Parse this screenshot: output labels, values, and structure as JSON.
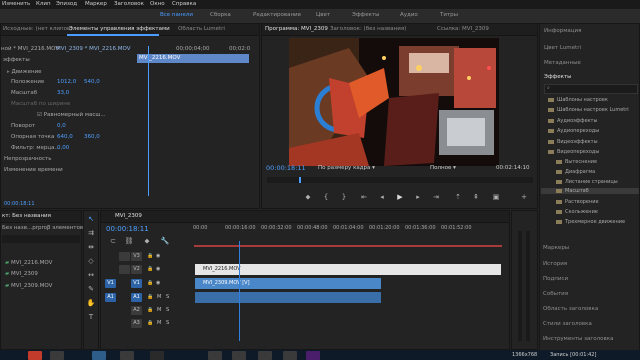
{
  "menubar": [
    "Изменить",
    "Клип",
    "Эпизод",
    "Маркер",
    "Заголовок",
    "Окно",
    "Справка"
  ],
  "workspaces": [
    {
      "label": "Все панели",
      "active": true
    },
    {
      "label": "Сборка",
      "active": false
    },
    {
      "label": "Редактирование",
      "active": false
    },
    {
      "label": "Цвет",
      "active": false
    },
    {
      "label": "Эффекты",
      "active": false
    },
    {
      "label": "Аудио",
      "active": false
    },
    {
      "label": "Титры",
      "active": false
    }
  ],
  "source_panel": {
    "tabs": [
      "Исходные: (нет клипов)",
      "Элементы управления эффектами",
      "Область Lumetri"
    ],
    "header_path": "ной * MVI_2216.MOV",
    "header_seq": "MVI_2309 * MVI_2216.MOV",
    "ruler_times": [
      "00;00;04;00",
      "00;02:0"
    ],
    "clip_name": "MVI_2216.MOV",
    "section": "эффекты",
    "rows": [
      {
        "label": "Движение",
        "value1": "",
        "value2": ""
      },
      {
        "label": "Положение",
        "value1": "1012,0",
        "value2": "540,0"
      },
      {
        "label": "Масштаб",
        "value1": "33,0",
        "value2": ""
      },
      {
        "label": "Масштаб по ширине",
        "value1": "",
        "value2": ""
      },
      {
        "label": "Равномерный масш...",
        "value1": "",
        "value2": ""
      },
      {
        "label": "Поворот",
        "value1": "0,0",
        "value2": ""
      },
      {
        "label": "Опорная точка",
        "value1": "640,0",
        "value2": "360,0"
      },
      {
        "label": "Фильтр: мерца...",
        "value1": "0,00",
        "value2": ""
      },
      {
        "label": "Непрозрачность",
        "value1": "",
        "value2": ""
      },
      {
        "label": "Изменение времени",
        "value1": "",
        "value2": ""
      }
    ],
    "timecode": "00:00:18:11"
  },
  "program_monitor": {
    "tabs": [
      "Программа: MVI_2309",
      "Заголовок: (без названия)",
      "Ссылка: MVI_2309"
    ],
    "timecode": "00:00:18:11",
    "fit": "По размеру кадра",
    "quality": "Полное",
    "duration": "00:02:14:10"
  },
  "right_panel": {
    "items_top": [
      "Информация",
      "Цвет Lumetri",
      "Метаданные"
    ],
    "effects_tab": "Эффекты",
    "effects_tree": [
      {
        "label": "Шаблоны настроек",
        "indent": 0,
        "open": false
      },
      {
        "label": "Шаблоны настроек Lumetri",
        "indent": 0,
        "open": false
      },
      {
        "label": "Аудиоэффекты",
        "indent": 0,
        "open": false
      },
      {
        "label": "Аудиопереходы",
        "indent": 0,
        "open": false
      },
      {
        "label": "Видеоэффекты",
        "indent": 0,
        "open": false
      },
      {
        "label": "Видеопереходы",
        "indent": 0,
        "open": true
      },
      {
        "label": "Вытеснение",
        "indent": 1,
        "open": false
      },
      {
        "label": "Диафрагма",
        "indent": 1,
        "open": false
      },
      {
        "label": "Листание страницы",
        "indent": 1,
        "open": false
      },
      {
        "label": "Масштаб",
        "indent": 1,
        "open": false,
        "selected": true
      },
      {
        "label": "Растворение",
        "indent": 1,
        "open": false
      },
      {
        "label": "Скольжение",
        "indent": 1,
        "open": false
      },
      {
        "label": "Трехмерное движение",
        "indent": 1,
        "open": false
      }
    ],
    "items_bottom": [
      "Маркеры",
      "История",
      "Подписи",
      "События",
      "Область заголовка",
      "Стили заголовка",
      "Инструменты заголовка"
    ]
  },
  "project_panel": {
    "title": "кт: Без названия",
    "subtitle": "Без назв...prproj",
    "count": "3 элементов",
    "items": [
      "MVI_2216.MOV",
      "MVI_2309",
      "MVI_2309.MOV"
    ]
  },
  "timeline": {
    "tab": "MVI_2309",
    "timecode": "00:00:18:11",
    "ruler": [
      "00:00",
      "00:00:16:00",
      "00:00:32:00",
      "00:00:48:00",
      "00:01:04:00",
      "00:01:20:00",
      "00:01:36:00",
      "00:01:52:00"
    ],
    "tracks": [
      {
        "name": "V3",
        "type": "video",
        "selected": false
      },
      {
        "name": "V2",
        "type": "video",
        "selected": false
      },
      {
        "name": "V1",
        "type": "video",
        "selected": true
      },
      {
        "name": "A1",
        "type": "audio",
        "selected": true
      },
      {
        "name": "A2",
        "type": "audio",
        "selected": false
      },
      {
        "name": "A3",
        "type": "audio",
        "selected": false
      }
    ],
    "clips": [
      {
        "label": "MVI_2216.MOV",
        "track": "V2"
      },
      {
        "label": "MVI_2309.MOV [V]",
        "track": "V1"
      },
      {
        "label": "",
        "track": "A1"
      }
    ]
  },
  "statusbar": {
    "resolution": "1366x768",
    "recording": "Запись [00:01:42]"
  },
  "colors": {
    "accent": "#4c9cff",
    "playhead": "#2f7fe0",
    "video_clip": "#e6e6e6",
    "video_clip_v1": "#4a87c8",
    "audio_clip": "#3a6ea8"
  }
}
